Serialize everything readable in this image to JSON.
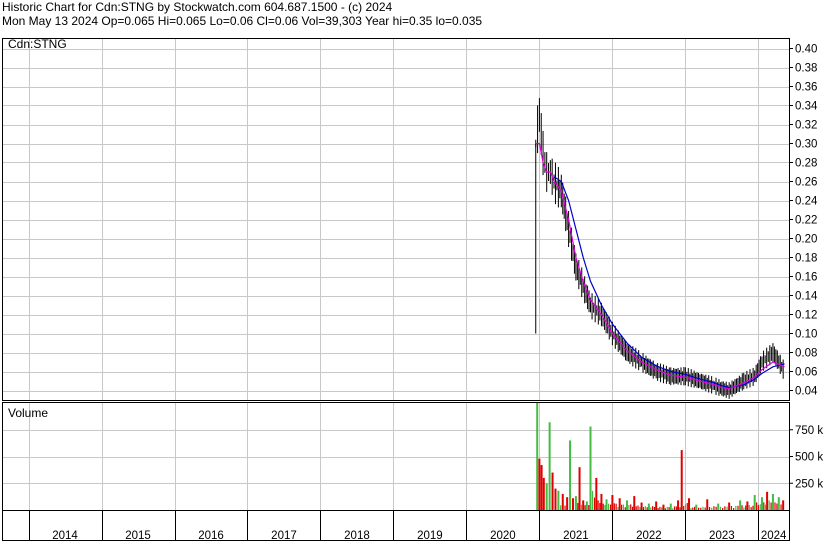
{
  "header": {
    "line1": "Historic Chart for Cdn:STNG by Stockwatch.com 604.687.1500 - (c) 2024",
    "line2": "Mon May 13 2024   Op=0.065   Hi=0.065   Lo=0.06   Cl=0.06   Vol=39,303   Year hi=0.35   lo=0.035"
  },
  "colors": {
    "grid": "#c8c8c8",
    "price_bar": "#000000",
    "ma_short": "#dd00dd",
    "ma_long": "#0000cc",
    "vol_down": "#e00000",
    "vol_up": "#44bb44"
  },
  "chart_data": [
    {
      "type": "line",
      "title": "Cdn:STNG",
      "ylim": [
        0.03,
        0.41
      ],
      "yticks": [
        "0.40",
        "0.38",
        "0.36",
        "0.34",
        "0.32",
        "0.30",
        "0.28",
        "0.26",
        "0.24",
        "0.22",
        "0.20",
        "0.18",
        "0.16",
        "0.14",
        "0.12",
        "0.10",
        "0.08",
        "0.06",
        "0.04"
      ],
      "x": [
        2020.95,
        2021.0,
        2021.05,
        2021.1,
        2021.15,
        2021.2,
        2021.3,
        2021.4,
        2021.5,
        2021.6,
        2021.7,
        2021.85,
        2022.0,
        2022.2,
        2022.4,
        2022.6,
        2022.8,
        2023.0,
        2023.2,
        2023.4,
        2023.5,
        2023.6,
        2023.8,
        2023.95,
        2024.05,
        2024.2,
        2024.36
      ],
      "series": [
        {
          "values": [
            0.3,
            0.33,
            0.29,
            0.27,
            0.27,
            0.26,
            0.25,
            0.21,
            0.17,
            0.15,
            0.13,
            0.12,
            0.1,
            0.08,
            0.07,
            0.06,
            0.055,
            0.055,
            0.05,
            0.045,
            0.042,
            0.04,
            0.05,
            0.055,
            0.07,
            0.08,
            0.06
          ]
        }
      ],
      "ma_short_values": [
        0.3,
        0.3,
        0.28,
        0.27,
        0.27,
        0.26,
        0.25,
        0.22,
        0.18,
        0.155,
        0.135,
        0.12,
        0.1,
        0.082,
        0.07,
        0.062,
        0.056,
        0.054,
        0.05,
        0.046,
        0.043,
        0.042,
        0.048,
        0.054,
        0.062,
        0.07,
        0.065
      ],
      "ma_long_values": [
        null,
        null,
        null,
        null,
        null,
        0.265,
        0.26,
        0.24,
        0.21,
        0.18,
        0.155,
        0.13,
        0.11,
        0.09,
        0.075,
        0.066,
        0.06,
        0.057,
        0.052,
        0.048,
        0.045,
        0.043,
        0.046,
        0.052,
        0.058,
        0.065,
        0.068
      ],
      "x_labels": [
        "2014",
        "2015",
        "2016",
        "2017",
        "2018",
        "2019",
        "2020",
        "2021",
        "2022",
        "2023",
        "2024"
      ],
      "x_label_years": [
        2014,
        2015,
        2016,
        2017,
        2018,
        2019,
        2020,
        2021,
        2022,
        2023,
        2024
      ]
    },
    {
      "type": "bar",
      "title": "Volume",
      "ylim": [
        0,
        1000
      ],
      "yticks": [
        "750 k",
        "500 k",
        "250 k"
      ],
      "x": [
        2020.97,
        2021.0,
        2021.03,
        2021.06,
        2021.1,
        2021.14,
        2021.18,
        2021.22,
        2021.26,
        2021.32,
        2021.38,
        2021.42,
        2021.46,
        2021.5,
        2021.55,
        2021.6,
        2021.65,
        2021.7,
        2021.78,
        2021.85,
        2021.92,
        2022.0,
        2022.1,
        2022.2,
        2022.3,
        2022.4,
        2022.5,
        2022.6,
        2022.7,
        2022.8,
        2022.9,
        2022.95,
        2023.05,
        2023.15,
        2023.3,
        2023.45,
        2023.6,
        2023.75,
        2023.85,
        2023.95,
        2024.05,
        2024.12,
        2024.2,
        2024.28,
        2024.34
      ],
      "values": [
        1000,
        480,
        420,
        300,
        250,
        820,
        350,
        200,
        180,
        150,
        120,
        650,
        110,
        130,
        400,
        90,
        80,
        780,
        300,
        150,
        100,
        140,
        110,
        90,
        130,
        70,
        60,
        80,
        50,
        60,
        90,
        560,
        110,
        50,
        100,
        60,
        70,
        90,
        80,
        140,
        120,
        170,
        150,
        120,
        90
      ],
      "up": [
        true,
        false,
        false,
        false,
        true,
        true,
        false,
        false,
        true,
        false,
        false,
        true,
        false,
        true,
        false,
        false,
        true,
        true,
        false,
        false,
        true,
        false,
        false,
        true,
        false,
        false,
        true,
        false,
        false,
        true,
        false,
        false,
        false,
        true,
        false,
        true,
        false,
        true,
        false,
        true,
        true,
        false,
        true,
        true,
        false
      ]
    }
  ]
}
